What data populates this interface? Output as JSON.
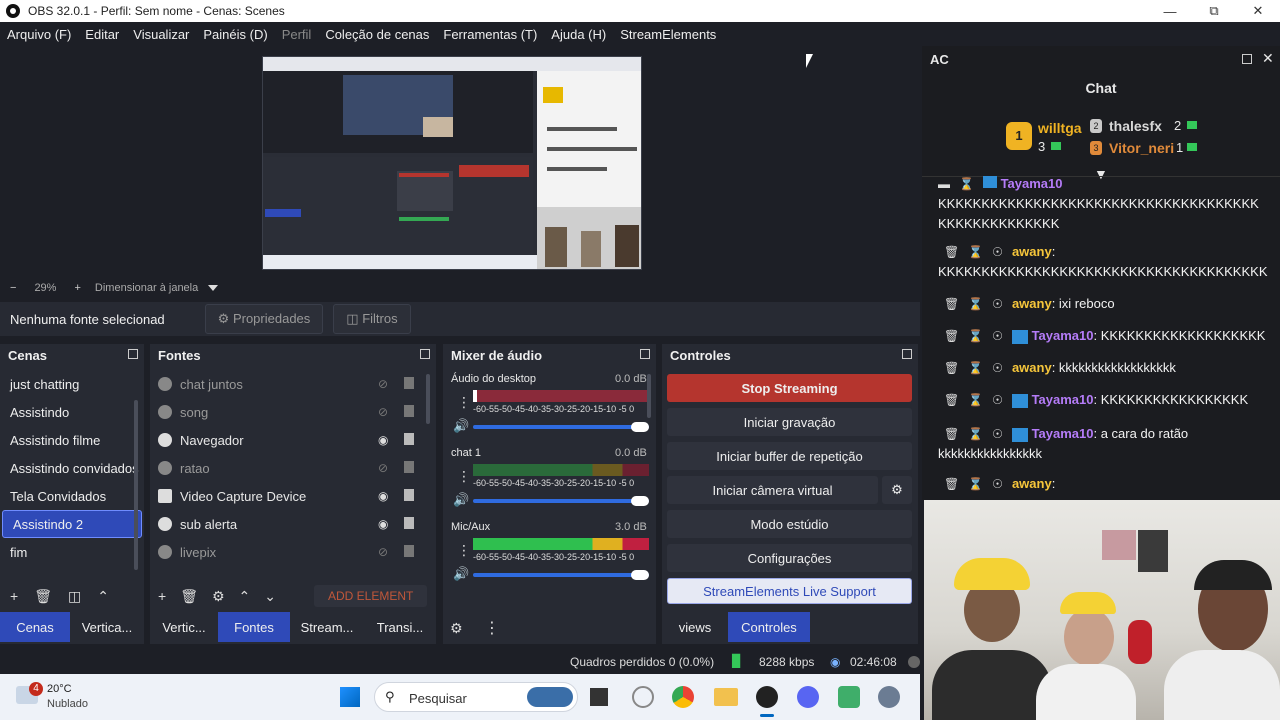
{
  "window": {
    "title": "OBS 32.0.1 - Perfil: Sem nome - Cenas: Scenes"
  },
  "menu": [
    "Arquivo (F)",
    "Editar",
    "Visualizar",
    "Painéis (D)",
    "Perfil",
    "Coleção de cenas",
    "Ferramentas (T)",
    "Ajuda (H)",
    "StreamElements"
  ],
  "zoom": {
    "percent": "29%",
    "fit_label": "Dimensionar à janela"
  },
  "source_bar": {
    "status": "Nenhuma fonte selecionad",
    "properties": "Propriedades",
    "filters": "Filtros"
  },
  "scenes": {
    "title": "Cenas",
    "items": [
      "just chatting",
      "Assistindo",
      "Assistindo filme",
      "Assistindo convidados",
      "Tela Convidados",
      "Assistindo 2",
      "fim"
    ],
    "selected": "Assistindo 2"
  },
  "sources": {
    "title": "Fontes",
    "items": [
      {
        "label": "chat juntos",
        "visible": false
      },
      {
        "label": "song",
        "visible": false
      },
      {
        "label": "Navegador",
        "visible": true
      },
      {
        "label": "ratao",
        "visible": false
      },
      {
        "label": "Video Capture Device",
        "visible": true
      },
      {
        "label": "sub alerta",
        "visible": true
      },
      {
        "label": "livepix",
        "visible": false
      }
    ],
    "add_element": "ADD ELEMENT"
  },
  "mixer": {
    "title": "Mixer de áudio",
    "channels": [
      {
        "name": "Áudio do desktop",
        "db": "0.0 dB",
        "level": 0.0
      },
      {
        "name": "chat 1",
        "db": "0.0 dB",
        "level": 0.0
      },
      {
        "name": "Mic/Aux",
        "db": "3.0 dB",
        "level": 0.55
      }
    ],
    "scale": "-60-55-50-45-40-35-30-25-20-15-10 -5  0"
  },
  "controls": {
    "title": "Controles",
    "stop_streaming": "Stop Streaming",
    "start_recording": "Iniciar gravação",
    "replay_buffer": "Iniciar buffer de repetição",
    "virtual_camera": "Iniciar câmera virtual",
    "studio_mode": "Modo estúdio",
    "settings": "Configurações",
    "se_support": "StreamElements Live Support"
  },
  "bottom_tabs": {
    "left": [
      "Cenas",
      "Vertica...",
      "Vertic...",
      "Fontes",
      "Stream...",
      "Transi..."
    ],
    "right": [
      "views",
      "Controles"
    ]
  },
  "status": {
    "dropped": "Quadros perdidos 0 (0.0%)",
    "bitrate": "8288 kbps",
    "time": "02:46:08"
  },
  "taskbar": {
    "weather_temp": "20°C",
    "weather_desc": "Nublado",
    "weather_badge": "4",
    "search_placeholder": "Pesquisar"
  },
  "chat": {
    "panel_title": "AC",
    "title": "Chat",
    "leaderboard": [
      {
        "rank": "1",
        "name": "willtga",
        "count": "3"
      },
      {
        "rank": "2",
        "name": "thalesfx",
        "count": "2"
      },
      {
        "rank": "3",
        "name": "Vitor_neri",
        "count": "1"
      }
    ],
    "messages": [
      {
        "user": "Tayama10",
        "text": "KKKKKKKKKKKKKKKKKKKKKKKKKKKKKKKKKKKKKKKKKKKKKKKKKKK"
      },
      {
        "user": "awany",
        "text": "KKKKKKKKKKKKKKKKKKKKKKKKKKKKKKKKKKKKKK"
      },
      {
        "user": "awany",
        "text": "ixi reboco"
      },
      {
        "user": "Tayama10",
        "text": "KKKKKKKKKKKKKKKKKKK"
      },
      {
        "user": "awany",
        "text": "kkkkkkkkkkkkkkkkkk"
      },
      {
        "user": "Tayama10",
        "text": "KKKKKKKKKKKKKKKKK"
      },
      {
        "user": "Tayama10",
        "text": "a cara do ratão kkkkkkkkkkkkkkkk"
      },
      {
        "user": "awany",
        "text": ""
      }
    ]
  },
  "colors": {
    "accent": "#2f4ab8",
    "stop": "#b5352e",
    "bg": "#1d1f26",
    "panel": "#272a33"
  }
}
